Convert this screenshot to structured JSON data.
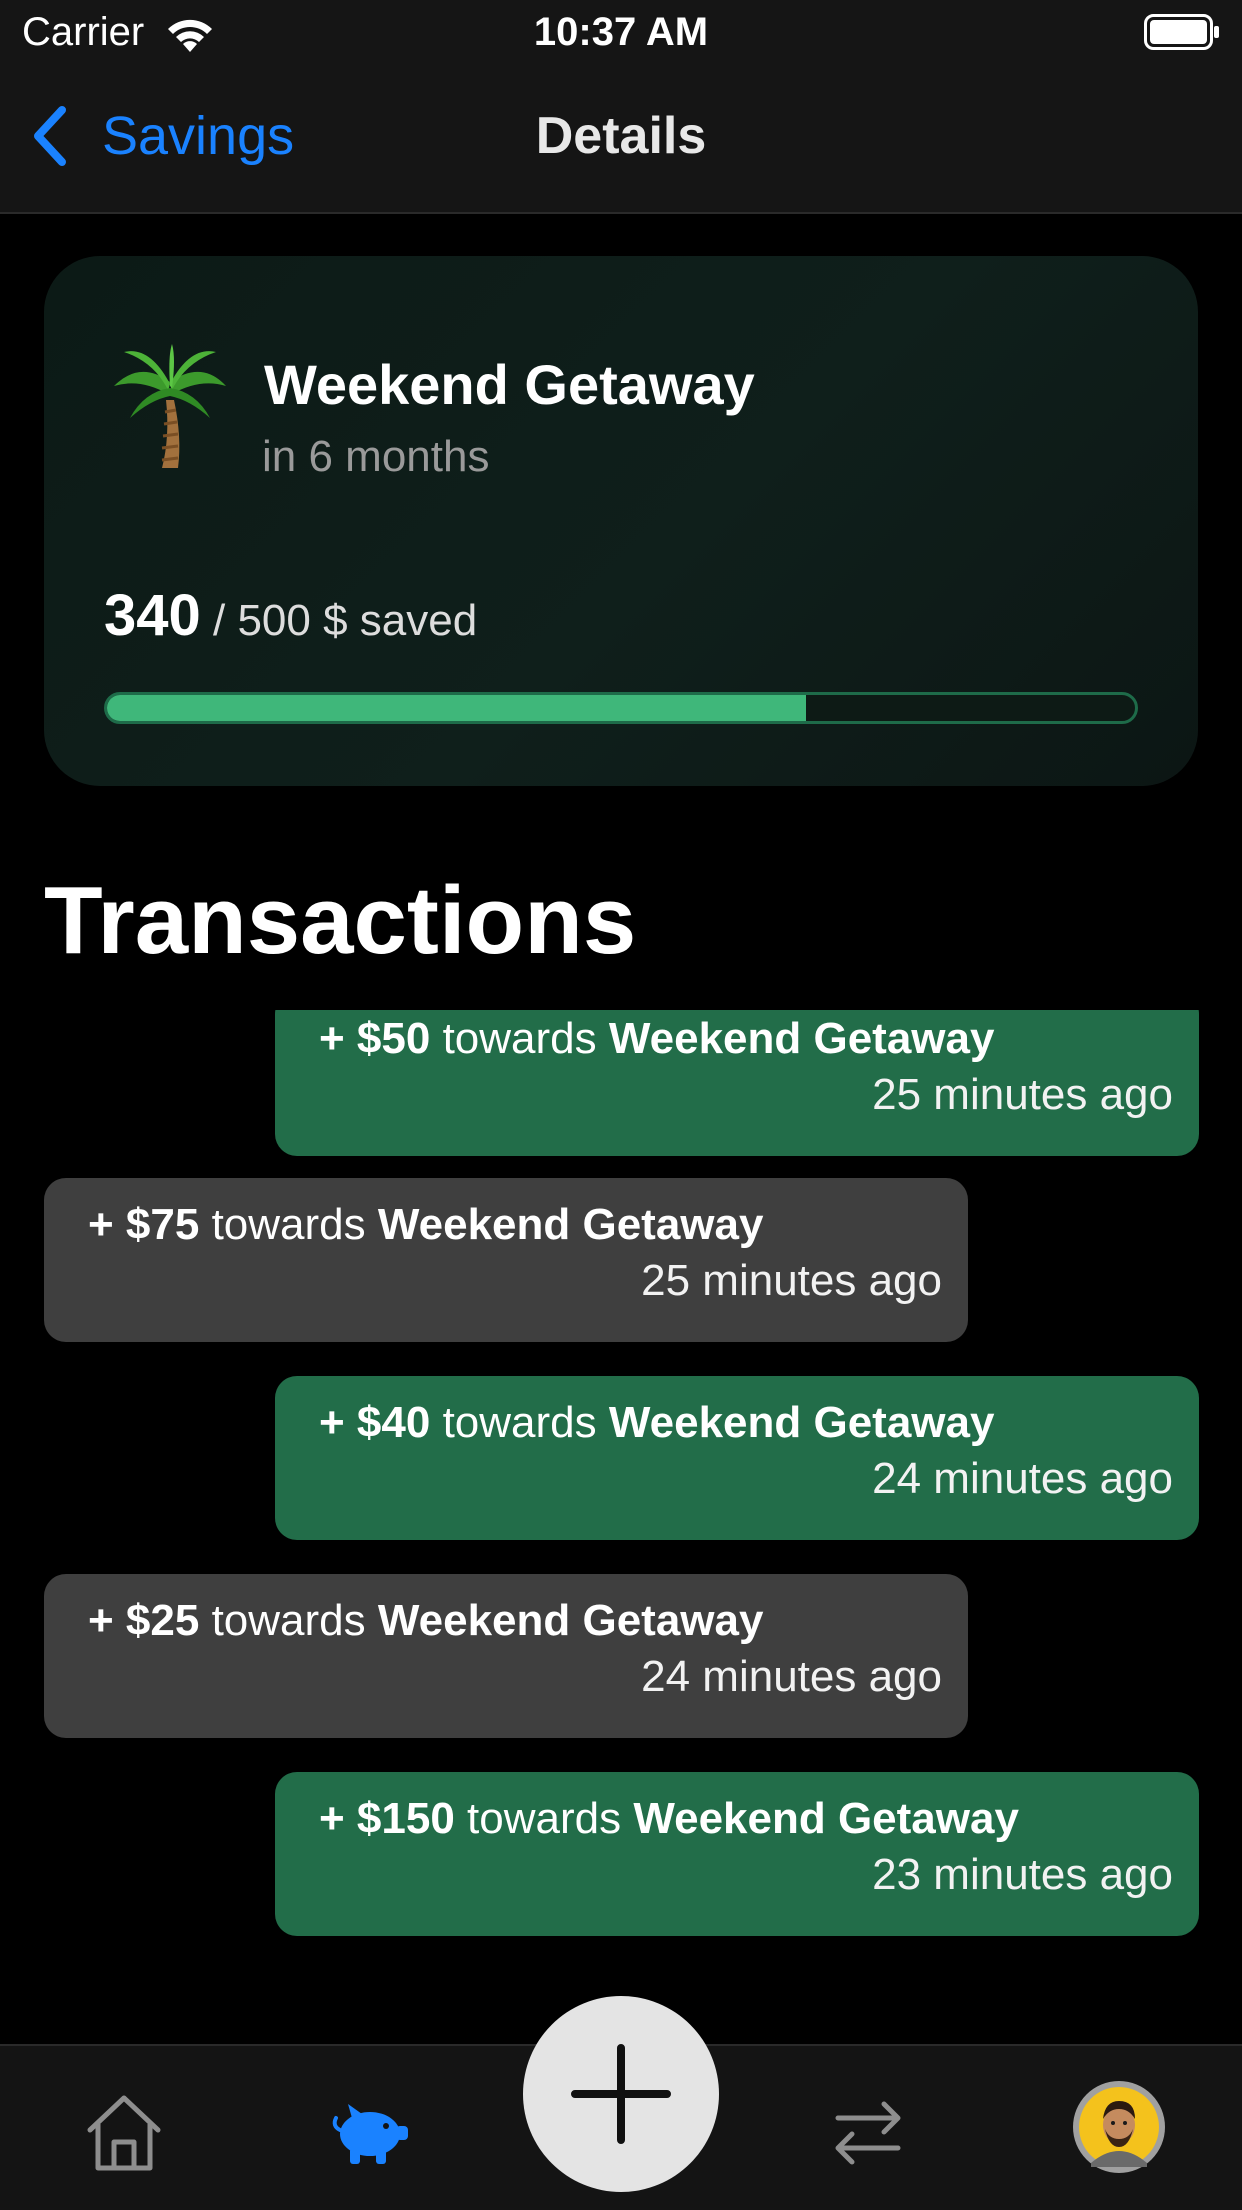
{
  "status_bar": {
    "carrier": "Carrier",
    "time": "10:37 AM"
  },
  "nav": {
    "back_label": "Savings",
    "title": "Details"
  },
  "goal": {
    "name": "Weekend Getaway",
    "timeframe": "in 6 months",
    "saved_amount": "340",
    "saved_suffix": "/ 500 $ saved",
    "progress": 0.68,
    "emoji_icon": "palm-tree-icon"
  },
  "transactions_title": "Transactions",
  "transactions": [
    {
      "amount": "+ $50",
      "connector": "towards",
      "goal": "Weekend Getaway",
      "time": "25 minutes ago",
      "style": "green"
    },
    {
      "amount": "+ $75",
      "connector": "towards",
      "goal": "Weekend Getaway",
      "time": "25 minutes ago",
      "style": "gray"
    },
    {
      "amount": "+ $40",
      "connector": "towards",
      "goal": "Weekend Getaway",
      "time": "24 minutes ago",
      "style": "green"
    },
    {
      "amount": "+ $25",
      "connector": "towards",
      "goal": "Weekend Getaway",
      "time": "24 minutes ago",
      "style": "gray"
    },
    {
      "amount": "+ $150",
      "connector": "towards",
      "goal": "Weekend Getaway",
      "time": "23 minutes ago",
      "style": "green"
    }
  ],
  "tab_bar": {
    "items": [
      {
        "icon": "home-icon",
        "active": false
      },
      {
        "icon": "piggy-bank-icon",
        "active": true
      },
      {
        "icon": "add-icon",
        "active": false
      },
      {
        "icon": "transfer-arrows-icon",
        "active": false
      },
      {
        "icon": "profile-avatar",
        "active": false
      }
    ]
  },
  "colors": {
    "accent": "#1a82ff",
    "green_bubble": "#226d49",
    "gray_bubble": "#3f3f3f",
    "progress_fill": "#3fb77a"
  }
}
